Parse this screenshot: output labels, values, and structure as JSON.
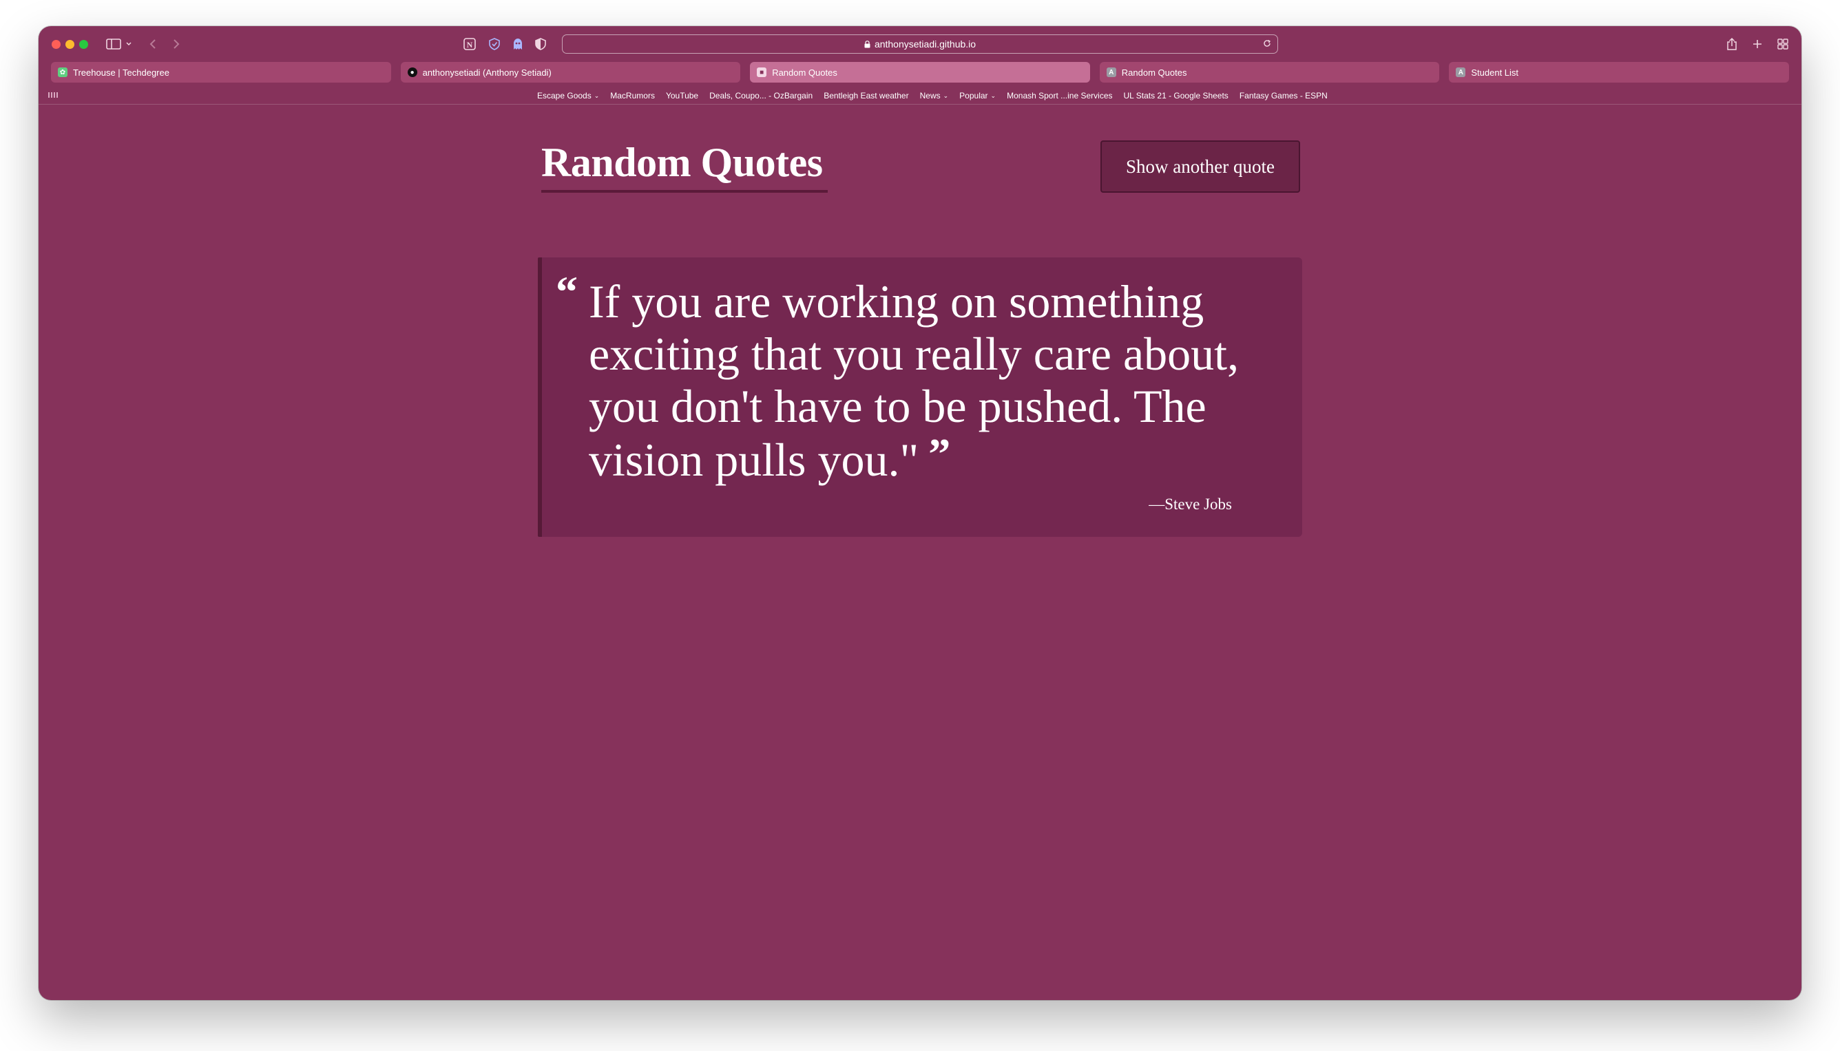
{
  "browser": {
    "url": "anthonysetiadi.github.io",
    "tabs": [
      {
        "title": "Treehouse | Techdegree",
        "favicon": "treehouse-icon",
        "active": false
      },
      {
        "title": "anthonysetiadi (Anthony Setiadi)",
        "favicon": "github-icon",
        "active": false
      },
      {
        "title": "Random Quotes",
        "favicon": "site-icon",
        "active": true
      },
      {
        "title": "Random Quotes",
        "favicon": "letter-a-icon",
        "active": false
      },
      {
        "title": "Student List",
        "favicon": "letter-a-icon",
        "active": false
      }
    ],
    "favorites": [
      {
        "label": "Escape Goods",
        "has_menu": true
      },
      {
        "label": "MacRumors",
        "has_menu": false
      },
      {
        "label": "YouTube",
        "has_menu": false
      },
      {
        "label": "Deals, Coupo... - OzBargain",
        "has_menu": false
      },
      {
        "label": "Bentleigh East weather",
        "has_menu": false
      },
      {
        "label": "News",
        "has_menu": true
      },
      {
        "label": "Popular",
        "has_menu": true
      },
      {
        "label": "Monash Sport ...ine Services",
        "has_menu": false
      },
      {
        "label": "UL Stats 21 - Google Sheets",
        "has_menu": false
      },
      {
        "label": "Fantasy Games - ESPN",
        "has_menu": false
      }
    ]
  },
  "page": {
    "title": "Random Quotes",
    "button_label": "Show another quote",
    "quote": {
      "open_mark": "“",
      "text": "If you are working on something exciting that you really care about, you don't have to be pushed. The vision pulls you.\"",
      "close_mark": "”",
      "source": "—Steve Jobs"
    },
    "colors": {
      "background": "#86325b",
      "quote_box": "#742750",
      "quote_border": "#561a37",
      "active_tab": "#c56f96"
    }
  }
}
